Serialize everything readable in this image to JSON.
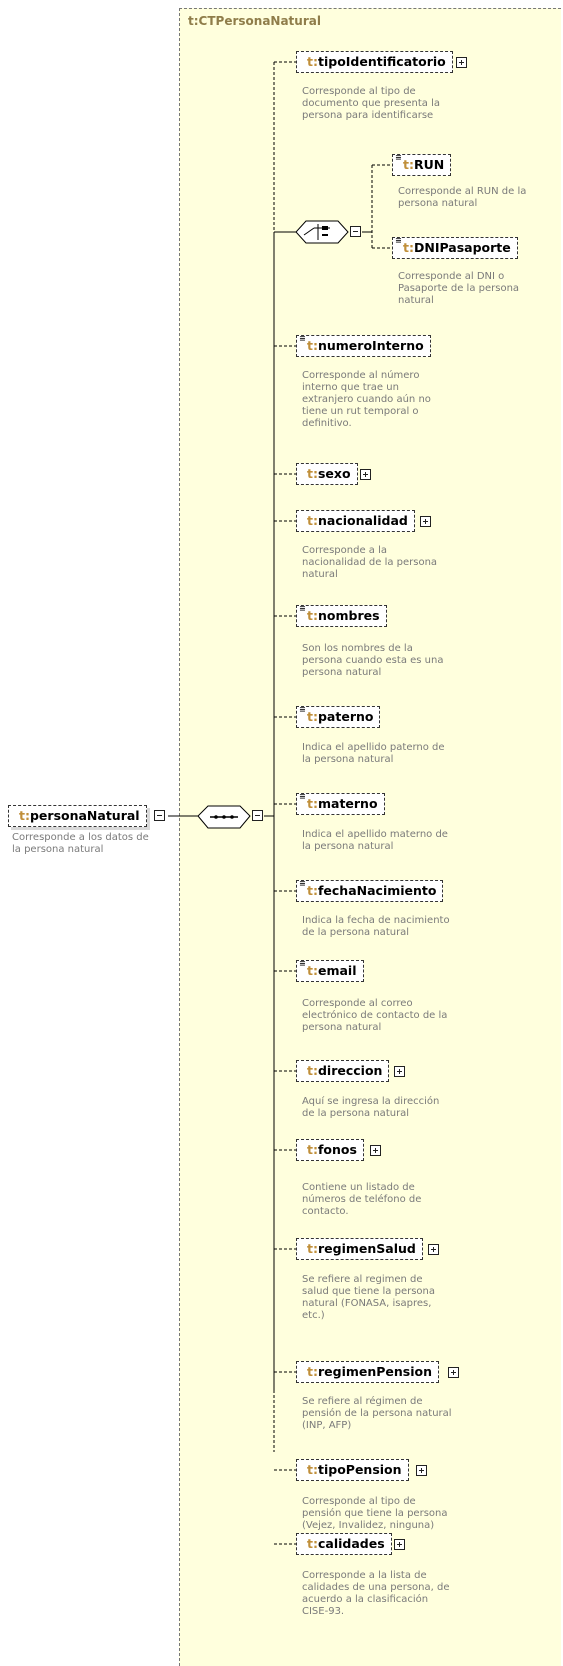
{
  "type_box": {
    "title_prefix": "t:",
    "title_name": "CTPersonaNatural"
  },
  "root": {
    "prefix": "t:",
    "name": "personaNatural",
    "doc": "Corresponde a los datos de\nla persona natural"
  },
  "choice": [
    {
      "prefix": "t:",
      "name": "RUN",
      "doc": "Corresponde al RUN de la\npersona natural"
    },
    {
      "prefix": "t:",
      "name": "DNIPasaporte",
      "doc": "Corresponde al DNI o\nPasaporte de la persona\nnatural"
    }
  ],
  "elements": [
    {
      "prefix": "t:",
      "name": "tipoIdentificatorio",
      "doc": "Corresponde al tipo de\ndocumento que presenta la\npersona para identificarse"
    },
    {
      "prefix": "t:",
      "name": "numeroInterno",
      "doc": "Corresponde al número\ninterno que trae un\nextranjero cuando aún no\ntiene un rut temporal o\ndefinitivo."
    },
    {
      "prefix": "t:",
      "name": "sexo",
      "doc": ""
    },
    {
      "prefix": "t:",
      "name": "nacionalidad",
      "doc": "Corresponde a la\nnacionalidad de la persona\nnatural"
    },
    {
      "prefix": "t:",
      "name": "nombres",
      "doc": "Son los nombres de la\npersona cuando esta es una\npersona natural"
    },
    {
      "prefix": "t:",
      "name": "paterno",
      "doc": "Indica el apellido paterno de\nla persona natural"
    },
    {
      "prefix": "t:",
      "name": "materno",
      "doc": "Indica el apellido materno de\nla persona natural"
    },
    {
      "prefix": "t:",
      "name": "fechaNacimiento",
      "doc": "Indica la fecha de nacimiento\nde la persona natural"
    },
    {
      "prefix": "t:",
      "name": "email",
      "doc": "Corresponde al correo\nelectrónico de contacto de la\npersona natural"
    },
    {
      "prefix": "t:",
      "name": "direccion",
      "doc": "Aquí se ingresa la dirección\nde la persona natural"
    },
    {
      "prefix": "t:",
      "name": "fonos",
      "doc": "Contiene un listado de\nnúmeros de teléfono de\ncontacto."
    },
    {
      "prefix": "t:",
      "name": "regimenSalud",
      "doc": "Se refiere al regimen de\nsalud que tiene la persona\nnatural (FONASA, isapres,\netc.)"
    },
    {
      "prefix": "t:",
      "name": "regimenPension",
      "doc": "Se refiere al régimen de\npensión de la persona natural\n(INP, AFP)"
    },
    {
      "prefix": "t:",
      "name": "tipoPension",
      "doc": "Corresponde al tipo de\npensión que tiene la persona\n(Vejez, Invalidez, ninguna)"
    },
    {
      "prefix": "t:",
      "name": "calidades",
      "doc": "Corresponde a la lista de\ncalidades de una persona, de\nacuerdo a la clasificación\nCISE-93."
    }
  ]
}
